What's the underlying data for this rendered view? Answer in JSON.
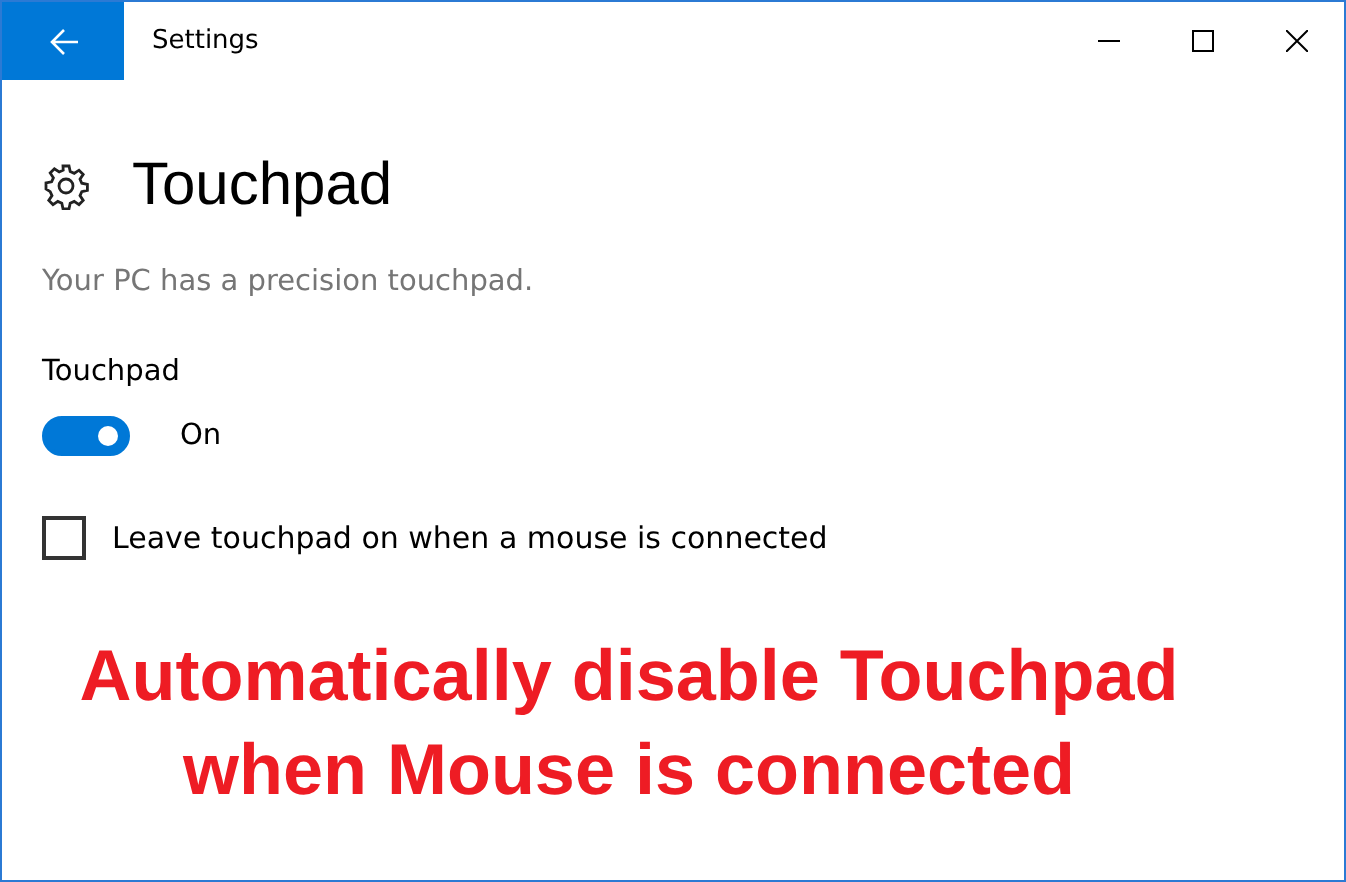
{
  "window": {
    "title": "Settings"
  },
  "page": {
    "title": "Touchpad",
    "description": "Your PC has a precision touchpad."
  },
  "toggle": {
    "label": "Touchpad",
    "on": true,
    "state_text": "On"
  },
  "checkbox": {
    "label": "Leave touchpad on when a mouse is connected",
    "checked": false
  },
  "annotation": [
    "Automatically disable Touchpad",
    "when Mouse is connected"
  ]
}
